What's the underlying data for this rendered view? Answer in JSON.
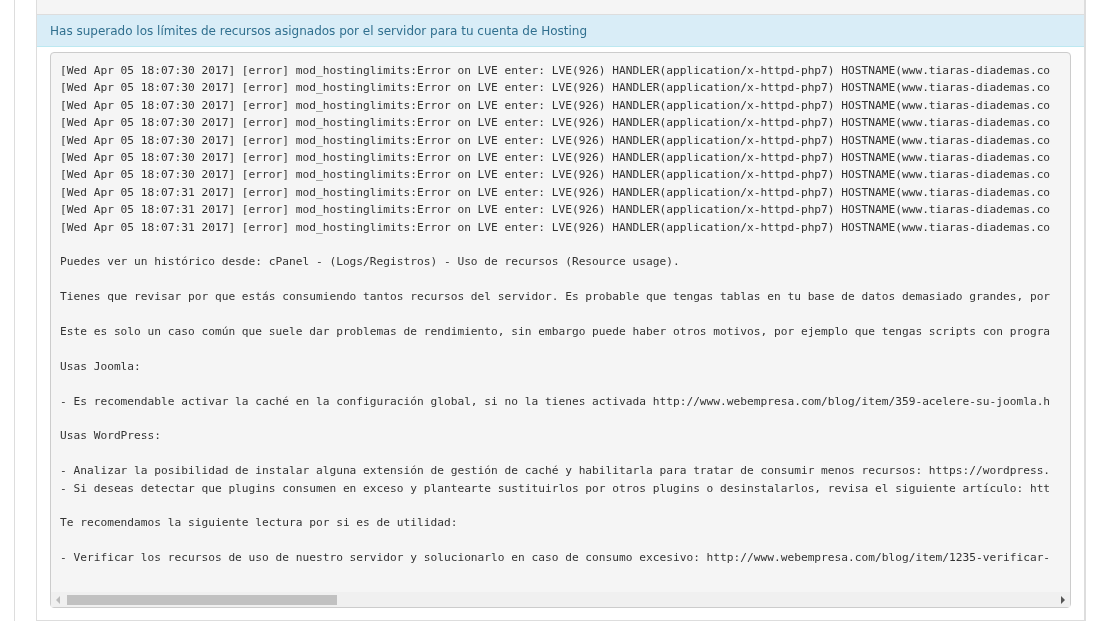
{
  "alert": {
    "text": "Has superado los límites de recursos asignados por el servidor para tu cuenta de Hosting"
  },
  "output": {
    "blocks": [
      {
        "lines": [
          "[Wed Apr 05 18:07:30 2017] [error] mod_hostinglimits:Error on LVE enter: LVE(926) HANDLER(application/x-httpd-php7) HOSTNAME(www.tiaras-diademas.co",
          "[Wed Apr 05 18:07:30 2017] [error] mod_hostinglimits:Error on LVE enter: LVE(926) HANDLER(application/x-httpd-php7) HOSTNAME(www.tiaras-diademas.co",
          "[Wed Apr 05 18:07:30 2017] [error] mod_hostinglimits:Error on LVE enter: LVE(926) HANDLER(application/x-httpd-php7) HOSTNAME(www.tiaras-diademas.co",
          "[Wed Apr 05 18:07:30 2017] [error] mod_hostinglimits:Error on LVE enter: LVE(926) HANDLER(application/x-httpd-php7) HOSTNAME(www.tiaras-diademas.co",
          "[Wed Apr 05 18:07:30 2017] [error] mod_hostinglimits:Error on LVE enter: LVE(926) HANDLER(application/x-httpd-php7) HOSTNAME(www.tiaras-diademas.co",
          "[Wed Apr 05 18:07:30 2017] [error] mod_hostinglimits:Error on LVE enter: LVE(926) HANDLER(application/x-httpd-php7) HOSTNAME(www.tiaras-diademas.co",
          "[Wed Apr 05 18:07:30 2017] [error] mod_hostinglimits:Error on LVE enter: LVE(926) HANDLER(application/x-httpd-php7) HOSTNAME(www.tiaras-diademas.co",
          "[Wed Apr 05 18:07:31 2017] [error] mod_hostinglimits:Error on LVE enter: LVE(926) HANDLER(application/x-httpd-php7) HOSTNAME(www.tiaras-diademas.co",
          "[Wed Apr 05 18:07:31 2017] [error] mod_hostinglimits:Error on LVE enter: LVE(926) HANDLER(application/x-httpd-php7) HOSTNAME(www.tiaras-diademas.co",
          "[Wed Apr 05 18:07:31 2017] [error] mod_hostinglimits:Error on LVE enter: LVE(926) HANDLER(application/x-httpd-php7) HOSTNAME(www.tiaras-diademas.co"
        ]
      },
      {
        "lines": [
          "Puedes ver un histórico desde: cPanel - (Logs/Registros) - Uso de recursos (Resource usage)."
        ]
      },
      {
        "lines": [
          "Tienes que revisar por que estás consumiendo tantos recursos del servidor. Es probable que tengas tablas en tu base de datos demasiado grandes, por"
        ]
      },
      {
        "lines": [
          "Este es solo un caso común que suele dar problemas de rendimiento, sin embargo puede haber otros motivos, por ejemplo que tengas scripts con progra"
        ]
      },
      {
        "lines": [
          "Usas Joomla:"
        ]
      },
      {
        "lines": [
          "- Es recomendable activar la caché en la configuración global, si no la tienes activada http://www.webempresa.com/blog/item/359-acelere-su-joomla.h"
        ]
      },
      {
        "lines": [
          "Usas WordPress:"
        ]
      },
      {
        "lines": [
          "- Analizar la posibilidad de instalar alguna extensión de gestión de caché y habilitarla para tratar de consumir menos recursos: https://wordpress.",
          "- Si deseas detectar que plugins consumen en exceso y plantearte sustituirlos por otros plugins o desinstalarlos, revisa el siguiente artículo: htt"
        ]
      },
      {
        "lines": [
          "Te recomendamos la siguiente lectura por si es de utilidad:"
        ]
      },
      {
        "lines": [
          "- Verificar los recursos de uso de nuestro servidor y solucionarlo en caso de consumo excesivo: http://www.webempresa.com/blog/item/1235-verificar-"
        ]
      }
    ]
  }
}
